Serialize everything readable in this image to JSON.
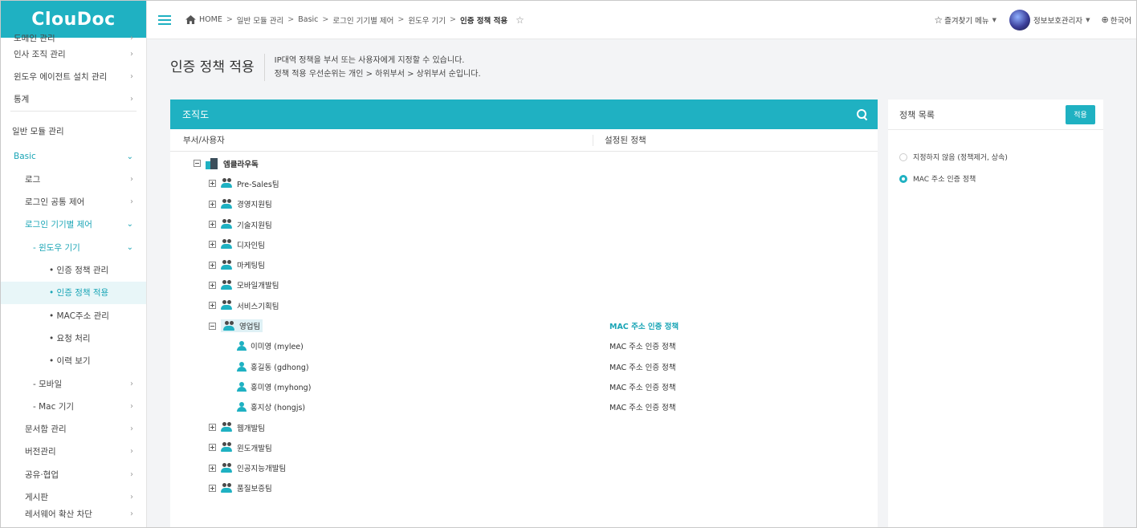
{
  "app": {
    "logo": "ClouDoc"
  },
  "sidebar": {
    "items_top": [
      {
        "label": "도메인 관리",
        "partial": true
      },
      {
        "label": "인사 조직 관리"
      },
      {
        "label": "윈도우 에이전트 설치 관리"
      },
      {
        "label": "통계"
      }
    ],
    "section": "일반 모듈 관리",
    "basic": "Basic",
    "log": "로그",
    "login_common": "로그인 공통 제어",
    "login_device": "로그인 기기별 제어",
    "windows_device": "- 윈도우 기기",
    "windows_children": [
      "• 인증 정책 관리",
      "• 인증 정책 적용",
      "• MAC주소 관리",
      "• 요청 처리",
      "• 이력 보기"
    ],
    "mobile": "- 모바일",
    "mac_device": "- Mac 기기",
    "items_bottom": [
      {
        "label": "문서함 관리"
      },
      {
        "label": "버전관리"
      },
      {
        "label": "공유·협업"
      },
      {
        "label": "게시판"
      },
      {
        "label": "레서웨어 확산 차단",
        "partial": true
      }
    ]
  },
  "topbar": {
    "breadcrumb": [
      "HOME",
      "일반 모듈 관리",
      "Basic",
      "로그인 기기별 제어",
      "윈도우 기기"
    ],
    "breadcrumb_current": "인증 정책 적용",
    "favorites": "즐겨찾기 메뉴",
    "user": "정보보호관리자",
    "language": "한국어"
  },
  "page": {
    "title": "인증 정책 적용",
    "desc_line1": "IP대역 정책을 부서 또는 사용자에게 지정할 수 있습니다.",
    "desc_line2": "정책 적용 우선순위는 개인 > 하위부서 > 상위부서 순입니다."
  },
  "org": {
    "title": "조직도",
    "col_user": "부서/사용자",
    "col_policy": "설정된 정책",
    "root": "엠클라우독",
    "teams_before": [
      "Pre-Sales팀",
      "경영지원팀",
      "기술지원팀",
      "디자인팀",
      "마케팅팀",
      "모바일개발팀",
      "서비스기획팀"
    ],
    "selected_team": {
      "name": "영업팀",
      "policy": "MAC 주소 인증 정책"
    },
    "members": [
      {
        "name": "이미영 (mylee)",
        "policy": "MAC 주소 인증 정책"
      },
      {
        "name": "홍길동 (gdhong)",
        "policy": "MAC 주소 인증 정책"
      },
      {
        "name": "홍미영 (myhong)",
        "policy": "MAC 주소 인증 정책"
      },
      {
        "name": "홍지상 (hongjs)",
        "policy": "MAC 주소 인증 정책"
      }
    ],
    "teams_after": [
      "웹개발팀",
      "윈도개발팀",
      "인공지능개발팀",
      "품질보증팀"
    ]
  },
  "policy": {
    "title": "정책 목록",
    "apply_label": "적용",
    "options": [
      {
        "label": "지정하지 않음 (정책제거, 상속)",
        "selected": false
      },
      {
        "label": "MAC 주소 인증 정책",
        "selected": true
      }
    ]
  },
  "colors": {
    "accent": "#1fb1c2",
    "highlight_text": "#1aa5b6"
  }
}
